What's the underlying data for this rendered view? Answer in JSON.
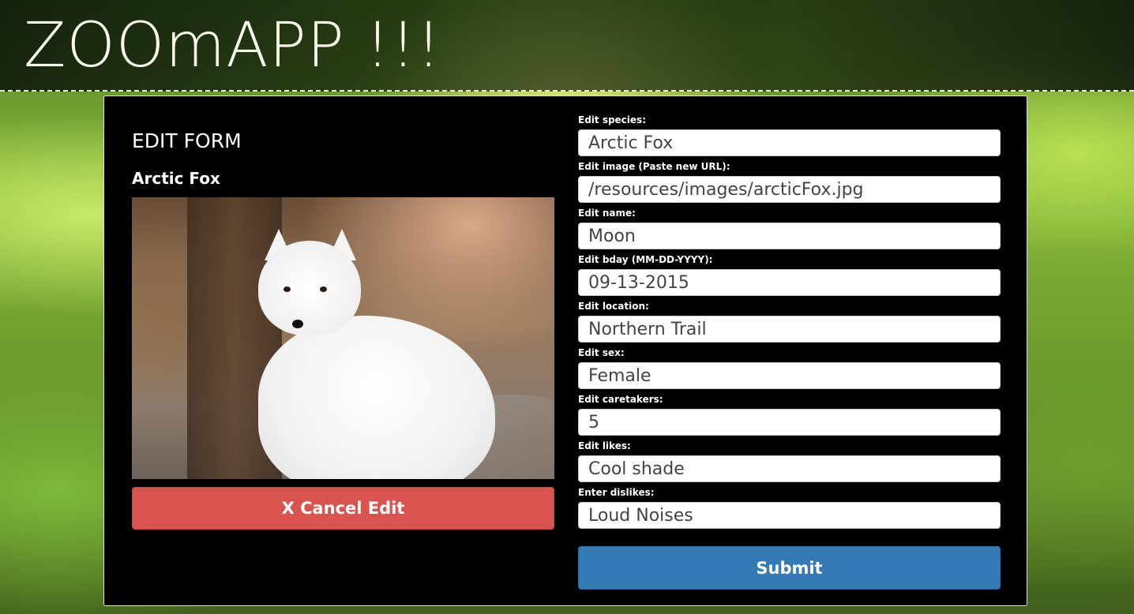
{
  "app": {
    "title": "ZOOmAPP !!!"
  },
  "form": {
    "heading": "EDIT FORM",
    "animal_name": "Arctic Fox",
    "cancel_label": "X Cancel Edit",
    "submit_label": "Submit",
    "fields": [
      {
        "label": "Edit species:",
        "value": "Arctic Fox"
      },
      {
        "label": "Edit image (Paste new URL):",
        "value": "/resources/images/arcticFox.jpg"
      },
      {
        "label": "Edit name:",
        "value": "Moon"
      },
      {
        "label": "Edit bday (MM-DD-YYYY):",
        "value": "09-13-2015"
      },
      {
        "label": "Edit location:",
        "value": "Northern Trail"
      },
      {
        "label": "Edit sex:",
        "value": "Female"
      },
      {
        "label": "Edit caretakers:",
        "value": "5"
      },
      {
        "label": "Edit likes:",
        "value": "Cool shade"
      },
      {
        "label": "Enter dislikes:",
        "value": "Loud Noises"
      }
    ]
  },
  "colors": {
    "cancel": "#d9534f",
    "submit": "#337ab7",
    "panel_background": "#000000"
  }
}
